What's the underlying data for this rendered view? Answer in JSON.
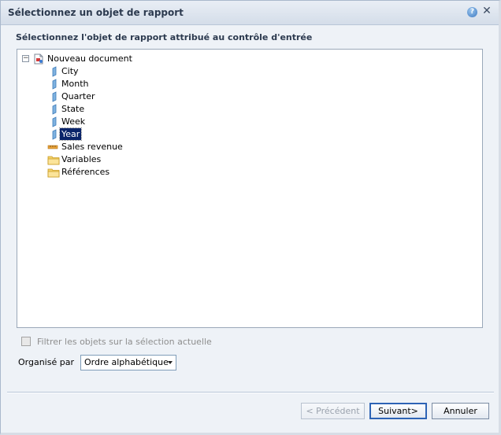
{
  "dialog": {
    "title": "Sélectionnez un objet de rapport",
    "help_icon": "help-icon",
    "close_icon": "close-icon",
    "prompt": "Sélectionnez l'objet de rapport attribué au contrôle d'entrée"
  },
  "tree": {
    "root": {
      "label": "Nouveau document",
      "icon": "document-icon",
      "expander": "⊟"
    },
    "items": [
      {
        "label": "City",
        "icon": "dimension-icon"
      },
      {
        "label": "Month",
        "icon": "dimension-icon"
      },
      {
        "label": "Quarter",
        "icon": "dimension-icon"
      },
      {
        "label": "State",
        "icon": "dimension-icon"
      },
      {
        "label": "Week",
        "icon": "dimension-icon"
      },
      {
        "label": "Year",
        "icon": "dimension-icon",
        "selected": true
      },
      {
        "label": "Sales revenue",
        "icon": "measure-icon"
      },
      {
        "label": "Variables",
        "icon": "folder-icon"
      },
      {
        "label": "Références",
        "icon": "folder-icon"
      }
    ]
  },
  "filter": {
    "label": "Filtrer les objets sur la sélection actuelle",
    "checked": false,
    "enabled": false
  },
  "organise": {
    "label": "Organisé par",
    "selected": "Ordre alphabétique"
  },
  "buttons": {
    "previous": "< Précédent",
    "next": "Suivant>",
    "cancel": "Annuler"
  },
  "colors": {
    "selection_bg": "#0a246a",
    "accent": "#2d63b5"
  }
}
